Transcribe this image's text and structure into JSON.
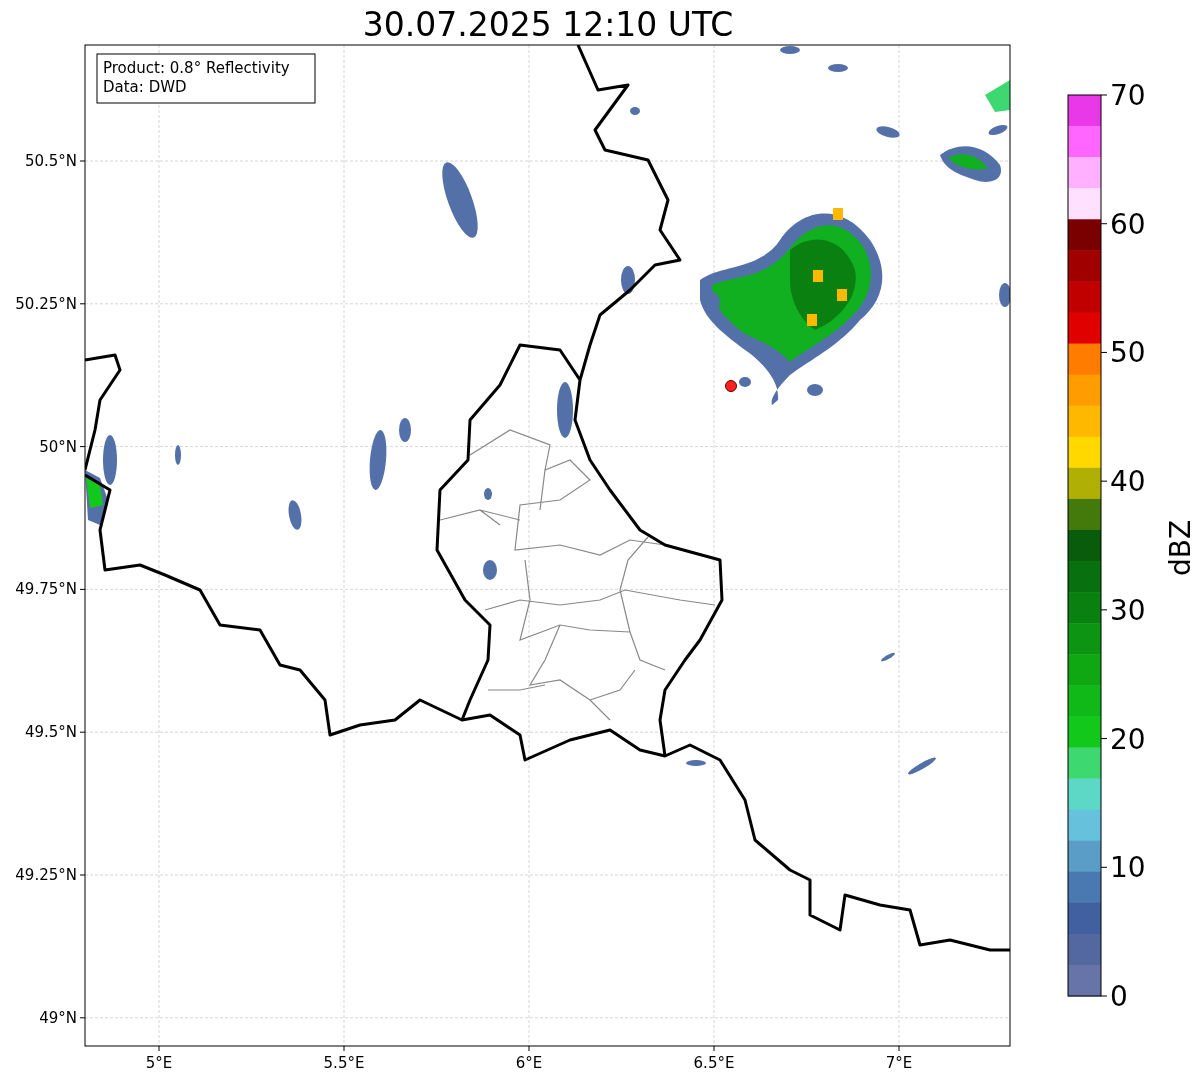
{
  "title": "30.07.2025 12:10 UTC",
  "info": [
    "Product: 0.8° Reflectivity",
    "Data: DWD"
  ],
  "map": {
    "xticks": [
      "5°E",
      "5.5°E",
      "6°E",
      "6.5°E",
      "7°E"
    ],
    "yticks": [
      "50.5°N",
      "50.25°N",
      "50°N",
      "49.75°N",
      "49.5°N",
      "49.25°N",
      "49°N"
    ]
  },
  "colorbar": {
    "label": "dBZ",
    "ticks": [
      "70",
      "60",
      "50",
      "40",
      "30",
      "20",
      "10",
      "0"
    ],
    "colors": [
      {
        "color": "#e838e8"
      },
      {
        "color": "#ff66ff"
      },
      {
        "color": "#ffb0ff"
      },
      {
        "color": "#ffe0ff"
      },
      {
        "color": "#7a0000"
      },
      {
        "color": "#a00000"
      },
      {
        "color": "#c00000"
      },
      {
        "color": "#e00000"
      },
      {
        "color": "#ff7c00"
      },
      {
        "color": "#ff9c00"
      },
      {
        "color": "#ffb800"
      },
      {
        "color": "#ffd800"
      },
      {
        "color": "#b0b004"
      },
      {
        "color": "#447a0c"
      },
      {
        "color": "#085c0c"
      },
      {
        "color": "#08700e"
      },
      {
        "color": "#0a8010"
      },
      {
        "color": "#0c9412"
      },
      {
        "color": "#0fa812"
      },
      {
        "color": "#10b818"
      },
      {
        "color": "#12c81a"
      },
      {
        "color": "#3ed870"
      },
      {
        "color": "#5ed8c6"
      },
      {
        "color": "#66c2dc"
      },
      {
        "color": "#5a9ec8"
      },
      {
        "color": "#4a78b0"
      },
      {
        "color": "#4060a0"
      },
      {
        "color": "#5468a0"
      },
      {
        "color": "#6674a8"
      }
    ]
  }
}
